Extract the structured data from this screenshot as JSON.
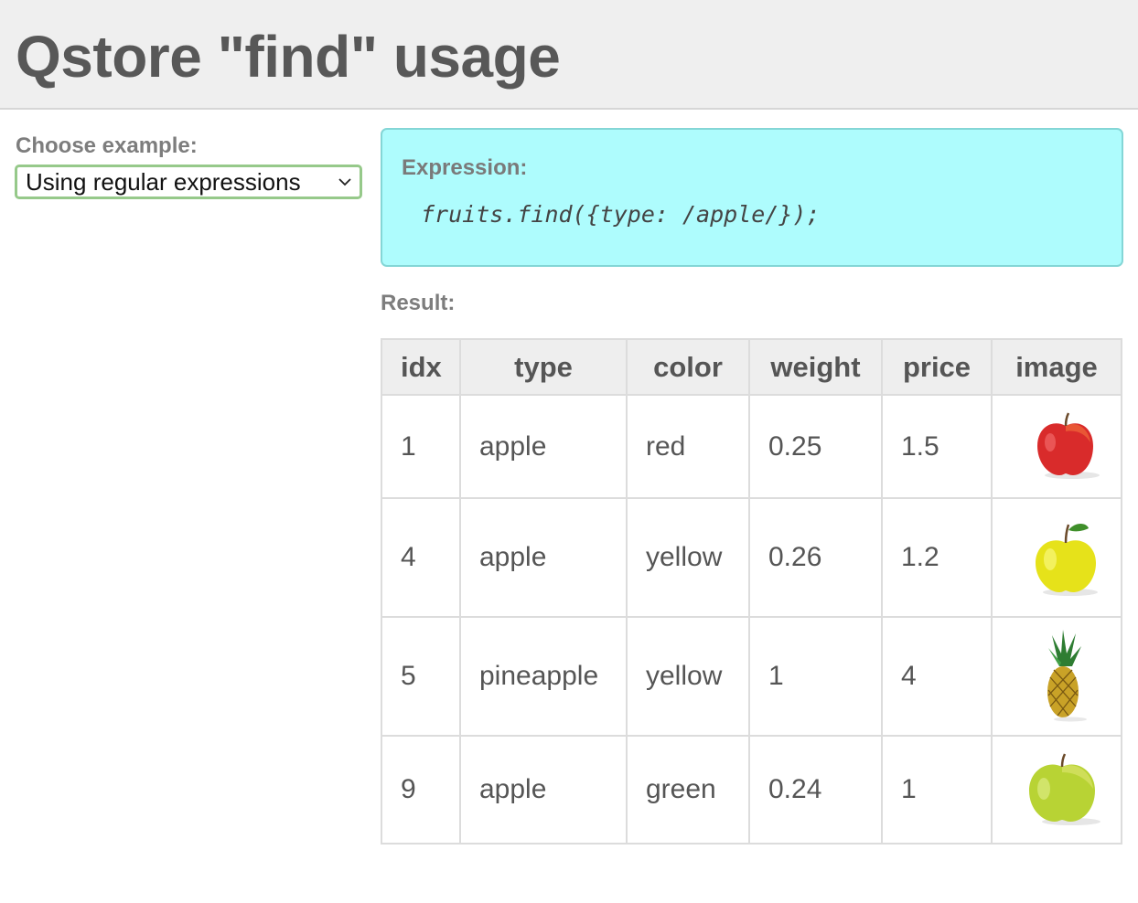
{
  "page": {
    "title": "Qstore \"find\" usage"
  },
  "controls": {
    "choose_label": "Choose example:",
    "selected_example": "Using regular expressions"
  },
  "expression": {
    "label": "Expression:",
    "code": "fruits.find({type: /apple/});"
  },
  "result": {
    "label": "Result:",
    "columns": [
      "idx",
      "type",
      "color",
      "weight",
      "price",
      "image"
    ],
    "rows": [
      {
        "idx": "1",
        "type": "apple",
        "color": "red",
        "weight": "0.25",
        "price": "1.5",
        "image": "red-apple-image"
      },
      {
        "idx": "4",
        "type": "apple",
        "color": "yellow",
        "weight": "0.26",
        "price": "1.2",
        "image": "yellow-apple-image"
      },
      {
        "idx": "5",
        "type": "pineapple",
        "color": "yellow",
        "weight": "1",
        "price": "4",
        "image": "pineapple-image"
      },
      {
        "idx": "9",
        "type": "apple",
        "color": "green",
        "weight": "0.24",
        "price": "1",
        "image": "green-apple-image"
      }
    ]
  },
  "colors": {
    "header_bg": "#efefef",
    "expression_bg": "#aefcfd",
    "select_border": "#96c98a"
  }
}
